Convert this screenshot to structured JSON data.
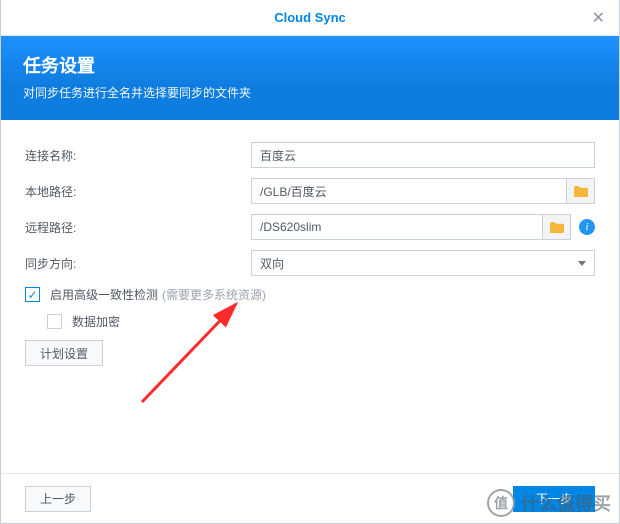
{
  "window": {
    "title": "Cloud Sync"
  },
  "banner": {
    "heading": "任务设置",
    "subheading": "对同步任务进行全名并选择要同步的文件夹"
  },
  "form": {
    "connection_name": {
      "label": "连接名称:",
      "value": "百度云"
    },
    "local_path": {
      "label": "本地路径:",
      "value": "/GLB/百度云"
    },
    "remote_path": {
      "label": "远程路径:",
      "value": "/DS620slim"
    },
    "sync_direction": {
      "label": "同步方向:",
      "value": "双向"
    },
    "consistency": {
      "label": "启用高级一致性检测",
      "hint": "(需要更多系统资源)"
    },
    "encryption": {
      "label": "数据加密"
    },
    "schedule_btn": "计划设置"
  },
  "footer": {
    "back": "上一步",
    "next": "下一步"
  },
  "watermark": {
    "badge": "值",
    "text": "什么值得买"
  }
}
